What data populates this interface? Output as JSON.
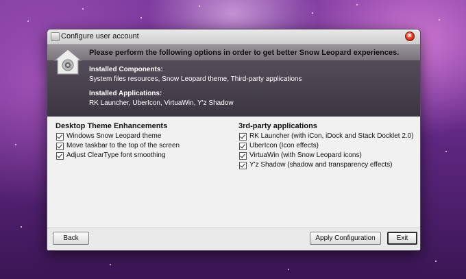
{
  "window": {
    "title": "Configure user account"
  },
  "header": {
    "heading": "Please perform the following options in order to get better Snow Leopard experiences.",
    "components_label": "Installed Components:",
    "components_value": "System files resources, Snow Leopard theme, Third-party applications",
    "applications_label": "Installed Applications:",
    "applications_value": "RK Launcher, UberIcon, VirtuaWin, Y'z Shadow"
  },
  "desktop_group": {
    "title": "Desktop Theme Enhancements",
    "items": [
      {
        "label": "Windows Snow Leopard theme",
        "checked": true
      },
      {
        "label": "Move taskbar to the top of the screen",
        "checked": true
      },
      {
        "label": "Adjust ClearType font smoothing",
        "checked": true
      }
    ]
  },
  "apps_group": {
    "title": "3rd-party applications",
    "items": [
      {
        "label": "RK Launcher (with iCon, iDock and Stack Docklet 2.0)",
        "checked": true
      },
      {
        "label": "UberIcon (Icon effects)",
        "checked": true
      },
      {
        "label": "VirtuaWin (with Snow Leopard icons)",
        "checked": true
      },
      {
        "label": "Y'z Shadow (shadow and transparency effects)",
        "checked": true
      }
    ]
  },
  "footer": {
    "back_label": "Back",
    "apply_label": "Apply Configuration",
    "exit_label": "Exit"
  },
  "icons": {
    "window_icon": "app-window-icon",
    "close_icon": "close-icon",
    "header_icon": "house-lock-icon"
  }
}
